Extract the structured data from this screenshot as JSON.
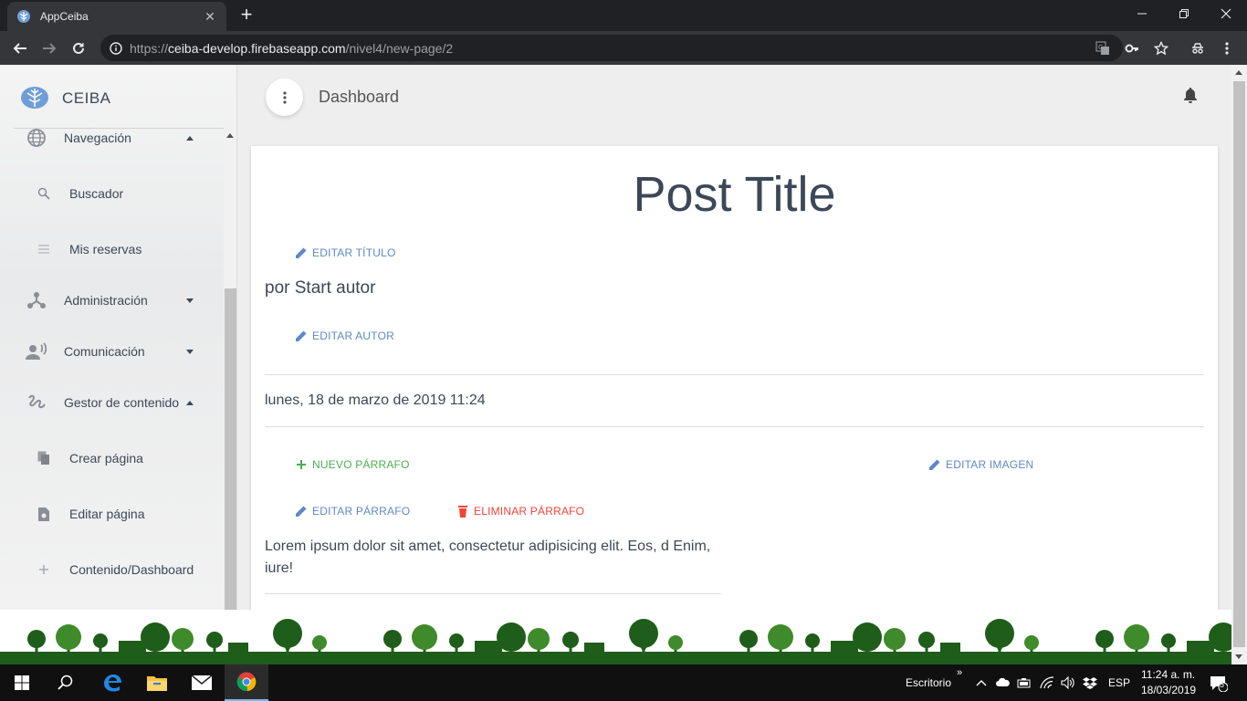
{
  "browser": {
    "tab_title": "AppCeiba",
    "url_scheme": "https://",
    "url_host": "ceiba-develop.firebaseapp.com",
    "url_path": "/nivel4/new-page/2"
  },
  "sidebar": {
    "brand": "CEIBA",
    "items": [
      {
        "label": "Navegación",
        "icon": "globe-icon",
        "expanded": true
      },
      {
        "label": "Buscador",
        "icon": "search-icon"
      },
      {
        "label": "Mis reservas",
        "icon": "list-icon"
      },
      {
        "label": "Administración",
        "icon": "hierarchy-icon",
        "expanded": false
      },
      {
        "label": "Comunicación",
        "icon": "record-voice-icon",
        "expanded": false
      },
      {
        "label": "Gestor de contenido",
        "icon": "gesture-icon",
        "expanded": true
      },
      {
        "label": "Crear página",
        "icon": "copy-icon"
      },
      {
        "label": "Editar página",
        "icon": "file-edit-icon"
      },
      {
        "label": "Contenido/Dashboard",
        "icon": "plus-icon"
      }
    ]
  },
  "main": {
    "page_title": "Dashboard",
    "post": {
      "title": "Post Title",
      "edit_title": "EDITAR TÍTULO",
      "author": "por Start autor",
      "edit_author": "EDITAR AUTOR",
      "date": "lunes, 18 de marzo de 2019 11:24",
      "new_paragraph": "NUEVO PÁRRAFO",
      "edit_image": "EDITAR IMAGEN",
      "edit_paragraph": "EDITAR PÁRRAFO",
      "delete_paragraph": "ELIMINAR PÁRRAFO",
      "paragraph_text": "Lorem ipsum dolor sit amet, consectetur adipisicing elit. Eos, d Enim, iure!"
    }
  },
  "taskbar": {
    "desktop_label": "Escritorio",
    "language": "ESP",
    "time": "11:24 a. m.",
    "date": "18/03/2019",
    "notifications": "5"
  },
  "colors": {
    "accent_blue": "#5f88c8",
    "green": "#4caf50",
    "red": "#f44336",
    "text": "#3c4858"
  }
}
